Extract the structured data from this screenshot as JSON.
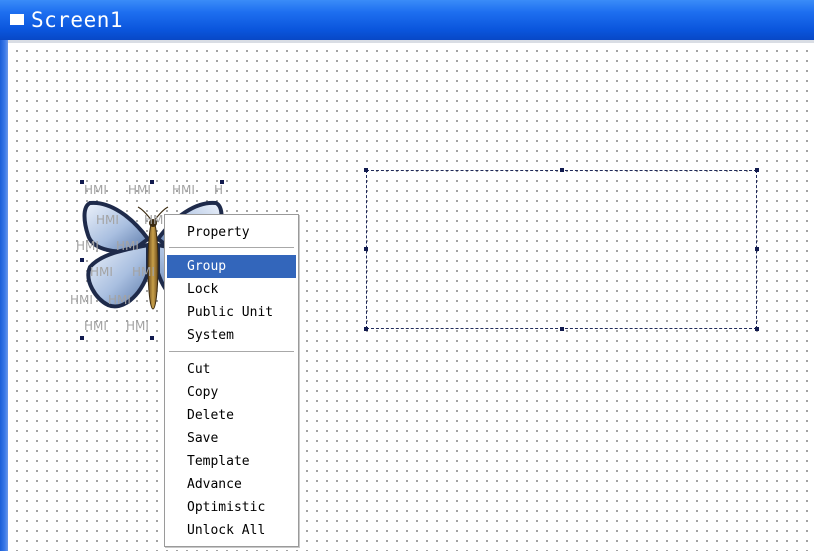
{
  "window": {
    "title": "Screen1"
  },
  "image_object": {
    "icon": "butterfly-image",
    "watermark": "HMI",
    "watermark_rows": [
      [
        "HMI",
        "HMI",
        "HMI",
        "H"
      ],
      [
        "HMI",
        "HMI"
      ],
      [
        "HMI",
        "HMI"
      ],
      [
        "HMI",
        "HMI"
      ],
      [
        "HMI",
        "HMI"
      ],
      [
        "HMI",
        "HMI"
      ]
    ]
  },
  "context_menu": {
    "top_items": [
      "Property"
    ],
    "middle_items": [
      "Group",
      "Lock",
      "Public Unit",
      "System"
    ],
    "bottom_items": [
      "Cut",
      "Copy",
      "Delete",
      "Save",
      "Template",
      "Advance",
      "Optimistic",
      "Unlock All"
    ],
    "highlighted": "Group"
  },
  "colors": {
    "titlebar": "#0a55dc",
    "highlight": "#3366bb",
    "handles": "#111a4e"
  }
}
